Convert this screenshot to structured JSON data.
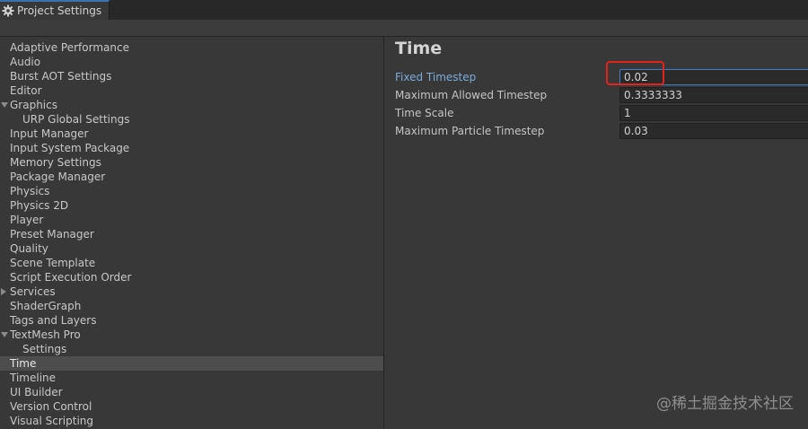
{
  "window": {
    "tab_title": "Project Settings",
    "tab_icon": "gear-icon"
  },
  "sidebar": {
    "items": [
      {
        "label": "Adaptive Performance"
      },
      {
        "label": "Audio"
      },
      {
        "label": "Burst AOT Settings"
      },
      {
        "label": "Editor"
      },
      {
        "label": "Graphics",
        "expanded": true
      },
      {
        "label": "URP Global Settings",
        "child": true
      },
      {
        "label": "Input Manager"
      },
      {
        "label": "Input System Package"
      },
      {
        "label": "Memory Settings"
      },
      {
        "label": "Package Manager"
      },
      {
        "label": "Physics"
      },
      {
        "label": "Physics 2D"
      },
      {
        "label": "Player"
      },
      {
        "label": "Preset Manager"
      },
      {
        "label": "Quality"
      },
      {
        "label": "Scene Template"
      },
      {
        "label": "Script Execution Order"
      },
      {
        "label": "Services",
        "collapsed": true
      },
      {
        "label": "ShaderGraph"
      },
      {
        "label": "Tags and Layers"
      },
      {
        "label": "TextMesh Pro",
        "expanded": true
      },
      {
        "label": "Settings",
        "child": true
      },
      {
        "label": "Time",
        "selected": true
      },
      {
        "label": "Timeline"
      },
      {
        "label": "UI Builder"
      },
      {
        "label": "Version Control"
      },
      {
        "label": "Visual Scripting"
      }
    ]
  },
  "main": {
    "title": "Time",
    "properties": [
      {
        "label": "Fixed Timestep",
        "value": "0.02",
        "focused": true
      },
      {
        "label": "Maximum Allowed Timestep",
        "value": "0.3333333"
      },
      {
        "label": "Time Scale",
        "value": "1"
      },
      {
        "label": "Maximum Particle Timestep",
        "value": "0.03"
      }
    ]
  },
  "watermark": "@稀土掘金技术社区",
  "colors": {
    "background": "#383838",
    "selected_row": "#4d4d4d",
    "active_label": "#7bacd9",
    "field_focus": "#3d7dc9",
    "annotation": "#e0241c"
  }
}
